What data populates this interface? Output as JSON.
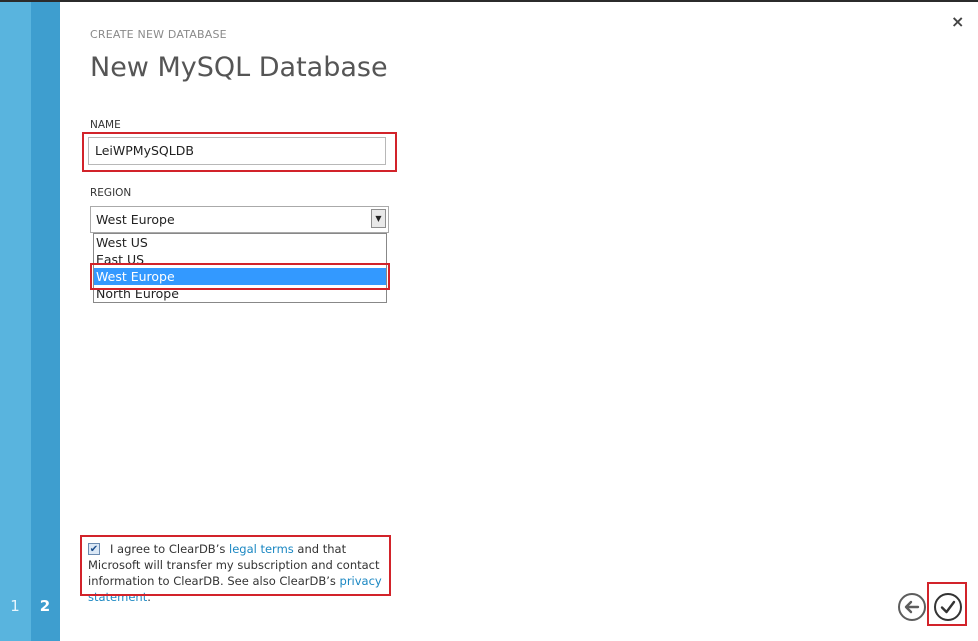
{
  "wizard": {
    "steps": [
      "1",
      "2"
    ],
    "close_glyph": "×"
  },
  "header": {
    "subtitle": "CREATE NEW DATABASE",
    "title": "New MySQL Database"
  },
  "form": {
    "name_label": "NAME",
    "name_value": "LeiWPMySQLDB",
    "region_label": "REGION",
    "region_selected": "West Europe",
    "region_options": [
      "West US",
      "East US",
      "West Europe",
      "North Europe"
    ]
  },
  "agreement": {
    "checked": true,
    "text_1": "I agree to ClearDB’s ",
    "legal_link": "legal terms",
    "text_2": " and that Microsoft will transfer my subscription and contact information to ClearDB. See also ClearDB’s ",
    "privacy_link": "privacy statement",
    "text_3": "."
  },
  "icons": {
    "back": "arrow-left-icon",
    "ok": "checkmark-icon",
    "close": "close-icon",
    "dropdown": "chevron-down-icon"
  },
  "colors": {
    "stripe_light": "#59b4de",
    "stripe_dark": "#3e9ecf",
    "highlight": "#d2232a",
    "selection": "#3399ff",
    "link": "#1a87c2"
  }
}
